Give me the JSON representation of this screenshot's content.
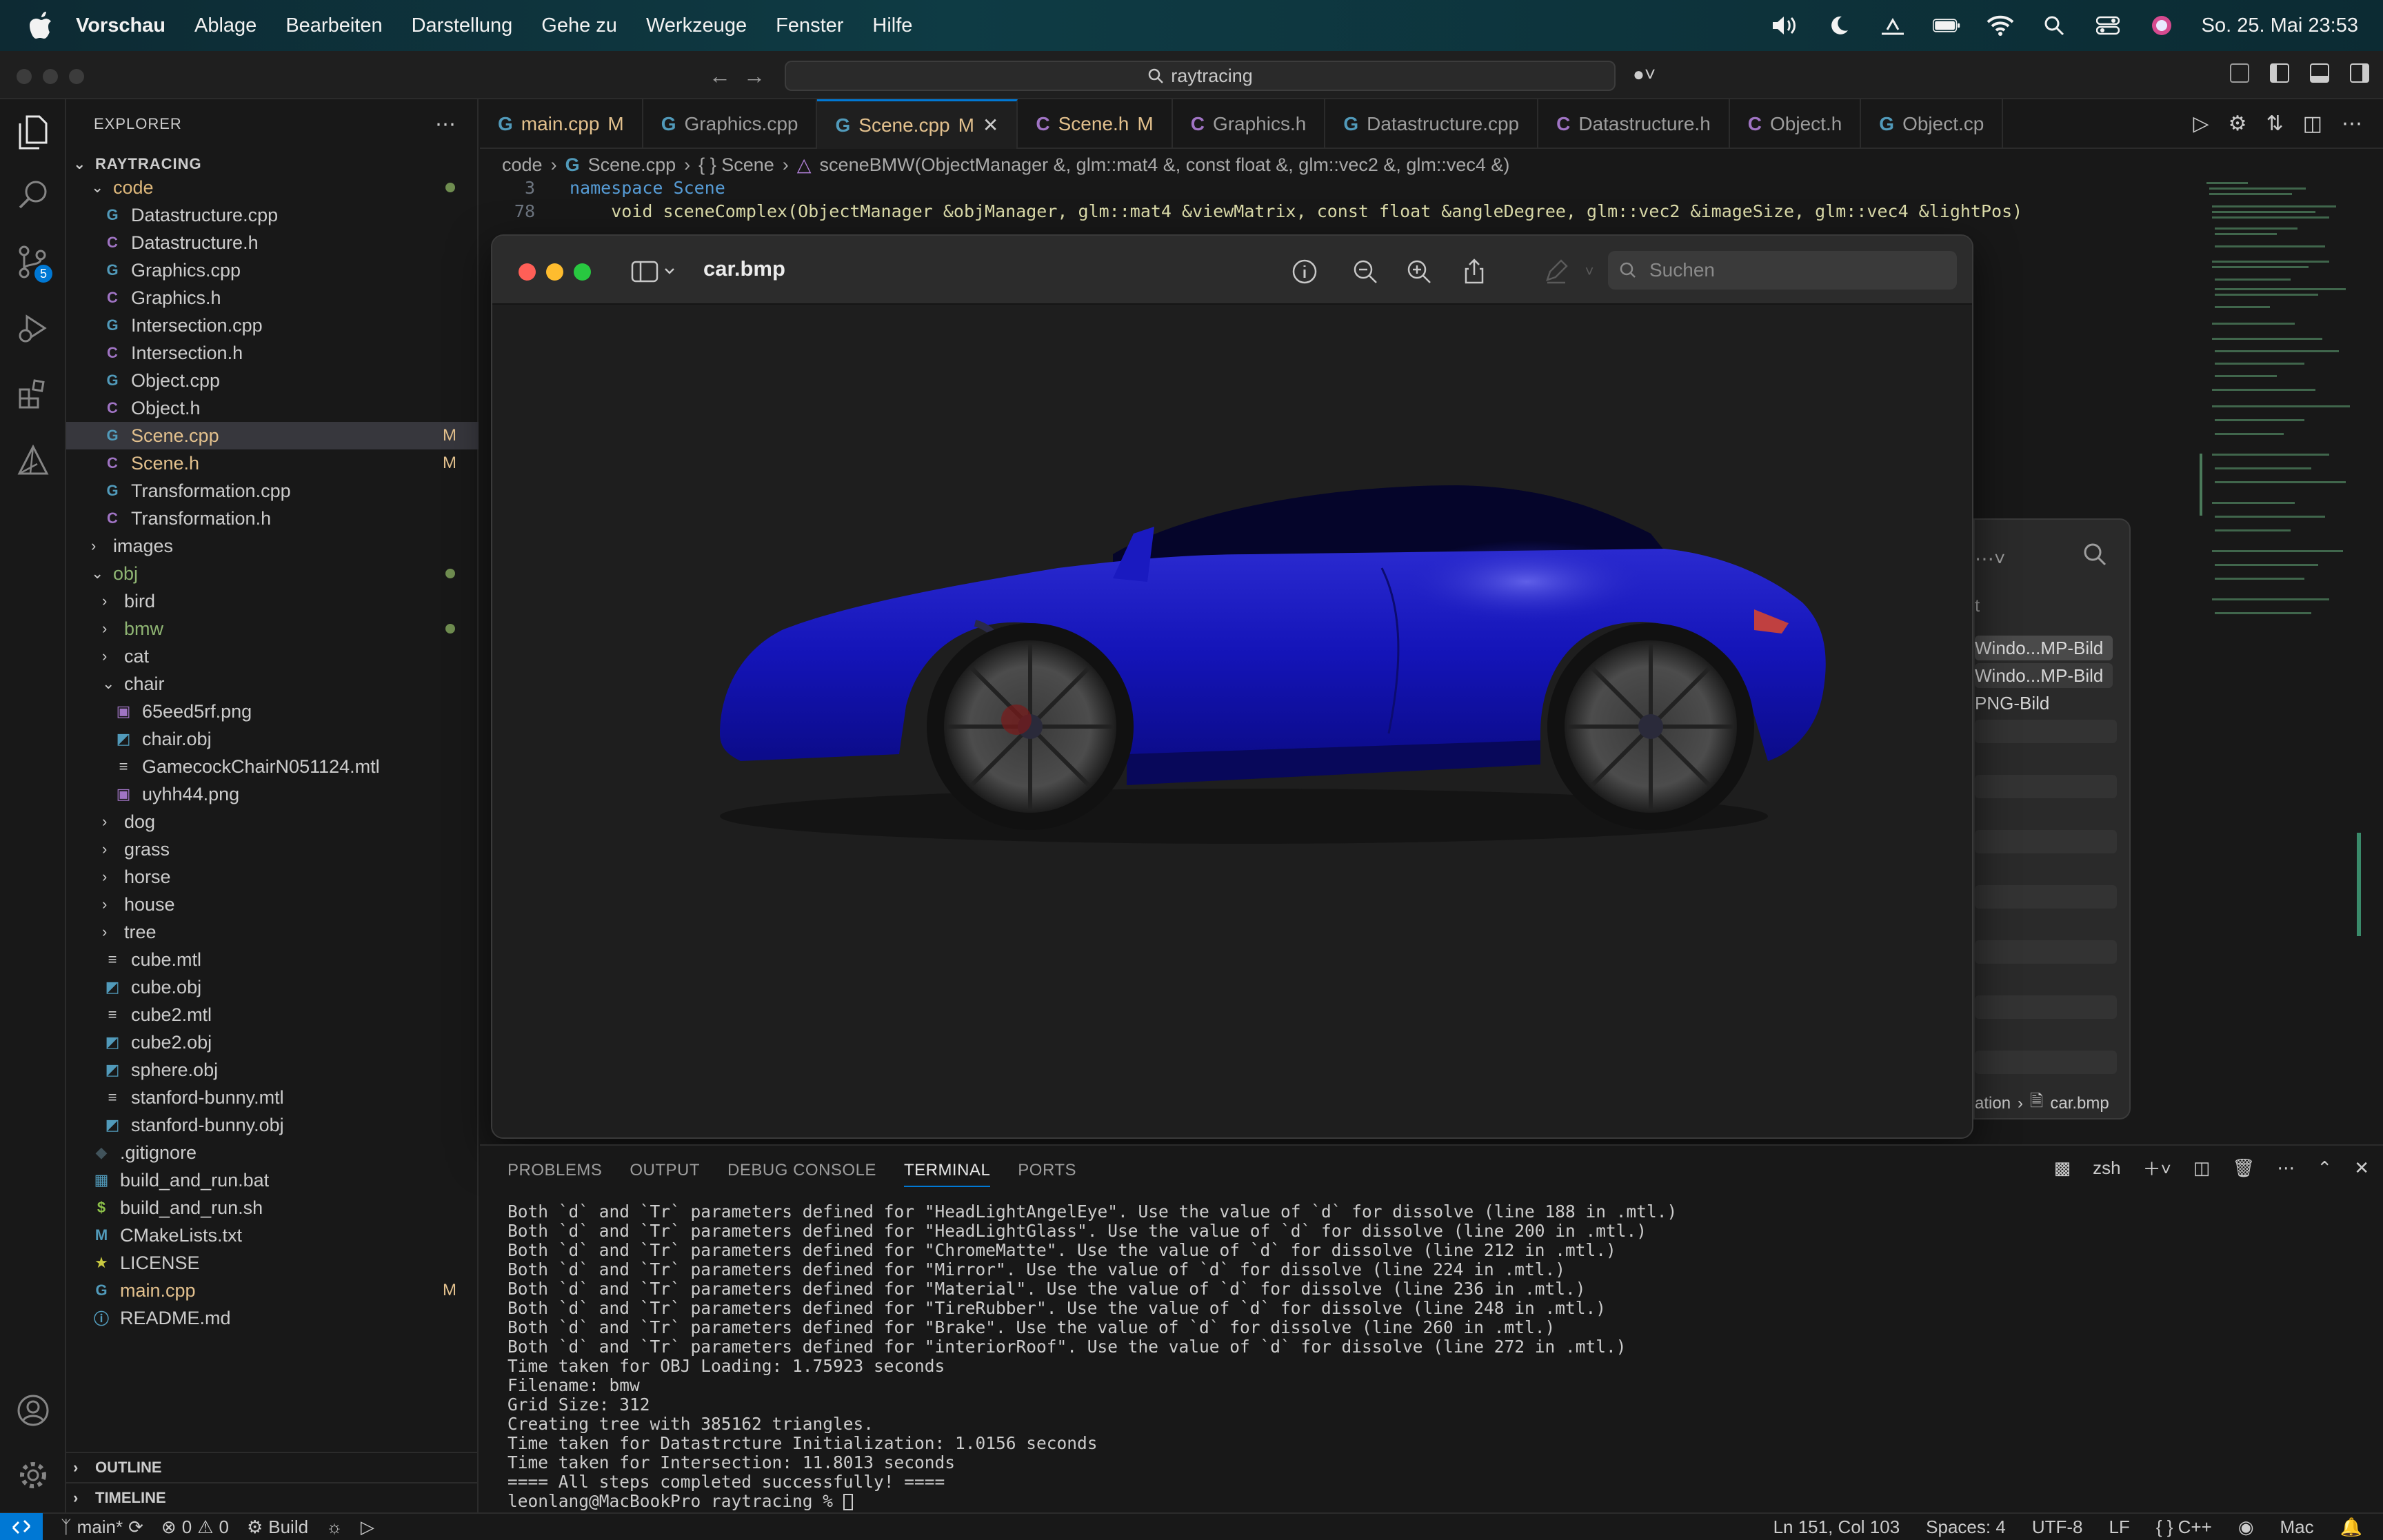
{
  "menubar": {
    "app": "Vorschau",
    "items": [
      "Ablage",
      "Bearbeiten",
      "Darstellung",
      "Gehe zu",
      "Werkzeuge",
      "Fenster",
      "Hilfe"
    ],
    "clock": "So. 25. Mai 23:53"
  },
  "titlebar": {
    "search": "raytracing"
  },
  "explorer": {
    "header": "EXPLORER",
    "root": "RAYTRACING",
    "outline": "OUTLINE",
    "timeline": "TIMELINE",
    "items": [
      {
        "label": "code",
        "kind": "folder-open",
        "depth": 1,
        "color": "#dcb67a",
        "dot": true
      },
      {
        "label": "Datastructure.cpp",
        "kind": "cpp",
        "depth": 2
      },
      {
        "label": "Datastructure.h",
        "kind": "h",
        "depth": 2
      },
      {
        "label": "Graphics.cpp",
        "kind": "cpp",
        "depth": 2
      },
      {
        "label": "Graphics.h",
        "kind": "h",
        "depth": 2
      },
      {
        "label": "Intersection.cpp",
        "kind": "cpp",
        "depth": 2
      },
      {
        "label": "Intersection.h",
        "kind": "h",
        "depth": 2
      },
      {
        "label": "Object.cpp",
        "kind": "cpp",
        "depth": 2
      },
      {
        "label": "Object.h",
        "kind": "h",
        "depth": 2
      },
      {
        "label": "Scene.cpp",
        "kind": "cpp",
        "depth": 2,
        "badge": "M",
        "selected": true,
        "color": "#e2c08d"
      },
      {
        "label": "Scene.h",
        "kind": "h",
        "depth": 2,
        "badge": "M",
        "color": "#e2c08d"
      },
      {
        "label": "Transformation.cpp",
        "kind": "cpp",
        "depth": 2
      },
      {
        "label": "Transformation.h",
        "kind": "h",
        "depth": 2
      },
      {
        "label": "images",
        "kind": "folder",
        "depth": 1
      },
      {
        "label": "obj",
        "kind": "folder-open",
        "depth": 1,
        "color": "#8fb573",
        "dot": true
      },
      {
        "label": "bird",
        "kind": "folder",
        "depth": 2
      },
      {
        "label": "bmw",
        "kind": "folder",
        "depth": 2,
        "color": "#8fb573",
        "dot": true
      },
      {
        "label": "cat",
        "kind": "folder",
        "depth": 2
      },
      {
        "label": "chair",
        "kind": "folder-open",
        "depth": 2
      },
      {
        "label": "65eed5rf.png",
        "kind": "img",
        "depth": 3
      },
      {
        "label": "chair.obj",
        "kind": "obj",
        "depth": 3
      },
      {
        "label": "GamecockChairN051124.mtl",
        "kind": "txt",
        "depth": 3
      },
      {
        "label": "uyhh44.png",
        "kind": "img",
        "depth": 3
      },
      {
        "label": "dog",
        "kind": "folder",
        "depth": 2
      },
      {
        "label": "grass",
        "kind": "folder",
        "depth": 2
      },
      {
        "label": "horse",
        "kind": "folder",
        "depth": 2
      },
      {
        "label": "house",
        "kind": "folder",
        "depth": 2
      },
      {
        "label": "tree",
        "kind": "folder",
        "depth": 2
      },
      {
        "label": "cube.mtl",
        "kind": "txt",
        "depth": 2
      },
      {
        "label": "cube.obj",
        "kind": "obj",
        "depth": 2
      },
      {
        "label": "cube2.mtl",
        "kind": "txt",
        "depth": 2
      },
      {
        "label": "cube2.obj",
        "kind": "obj",
        "depth": 2
      },
      {
        "label": "sphere.obj",
        "kind": "obj",
        "depth": 2
      },
      {
        "label": "stanford-bunny.mtl",
        "kind": "txt",
        "depth": 2
      },
      {
        "label": "stanford-bunny.obj",
        "kind": "obj",
        "depth": 2
      },
      {
        "label": ".gitignore",
        "kind": "git",
        "depth": 1
      },
      {
        "label": "build_and_run.bat",
        "kind": "bat",
        "depth": 1
      },
      {
        "label": "build_and_run.sh",
        "kind": "sh",
        "depth": 1
      },
      {
        "label": "CMakeLists.txt",
        "kind": "cmake",
        "depth": 1
      },
      {
        "label": "LICENSE",
        "kind": "license",
        "depth": 1
      },
      {
        "label": "main.cpp",
        "kind": "cpp",
        "depth": 1,
        "badge": "M",
        "color": "#e2c08d"
      },
      {
        "label": "README.md",
        "kind": "info",
        "depth": 1
      }
    ]
  },
  "tabs": [
    {
      "label": "main.cpp",
      "kind": "cpp",
      "badge": "M"
    },
    {
      "label": "Graphics.cpp",
      "kind": "cpp"
    },
    {
      "label": "Scene.cpp",
      "kind": "cpp",
      "badge": "M",
      "active": true
    },
    {
      "label": "Scene.h",
      "kind": "h",
      "badge": "M"
    },
    {
      "label": "Graphics.h",
      "kind": "h"
    },
    {
      "label": "Datastructure.cpp",
      "kind": "cpp"
    },
    {
      "label": "Datastructure.h",
      "kind": "h"
    },
    {
      "label": "Object.h",
      "kind": "h"
    },
    {
      "label": "Object.cp",
      "kind": "cpp"
    }
  ],
  "breadcrumb": [
    "code",
    "Scene.cpp",
    "{ } Scene",
    "sceneBMW(ObjectManager &, glm::mat4 &, const float &, glm::vec2 &, glm::vec4 &)"
  ],
  "code": {
    "line1_no": "3",
    "line1": "namespace Scene",
    "line2_no": "78",
    "line2": "    void sceneComplex(ObjectManager &objManager, glm::mat4 &viewMatrix, const float &angleDegree, glm::vec2 &imageSize, glm::vec4 &lightPos)"
  },
  "preview": {
    "title": "car.bmp",
    "search_placeholder": "Suchen",
    "car_color": "#1a1aa8"
  },
  "background_window": {
    "rows": [
      "Windo...MP-Bild",
      "Windo...MP-Bild",
      "PNG-Bild"
    ],
    "letter": "t",
    "path_prefix": "ation",
    "path_file": "car.bmp"
  },
  "panel": {
    "tabs": [
      "PROBLEMS",
      "OUTPUT",
      "DEBUG CONSOLE",
      "TERMINAL",
      "PORTS"
    ],
    "active_tab": "TERMINAL",
    "shell": "zsh",
    "terminal_lines": [
      "Both `d` and `Tr` parameters defined for \"HeadLightAngelEye\". Use the value of `d` for dissolve (line 188 in .mtl.)",
      "Both `d` and `Tr` parameters defined for \"HeadLightGlass\". Use the value of `d` for dissolve (line 200 in .mtl.)",
      "Both `d` and `Tr` parameters defined for \"ChromeMatte\". Use the value of `d` for dissolve (line 212 in .mtl.)",
      "Both `d` and `Tr` parameters defined for \"Mirror\". Use the value of `d` for dissolve (line 224 in .mtl.)",
      "Both `d` and `Tr` parameters defined for \"Material\". Use the value of `d` for dissolve (line 236 in .mtl.)",
      "Both `d` and `Tr` parameters defined for \"TireRubber\". Use the value of `d` for dissolve (line 248 in .mtl.)",
      "Both `d` and `Tr` parameters defined for \"Brake\". Use the value of `d` for dissolve (line 260 in .mtl.)",
      "Both `d` and `Tr` parameters defined for \"interiorRoof\". Use the value of `d` for dissolve (line 272 in .mtl.)",
      "Time taken for OBJ Loading: 1.75923 seconds",
      "Filename: bmw",
      "Grid Size: 312",
      "Creating tree with 385162 triangles.",
      "Time taken for Datastrcture Initialization: 1.0156 seconds",
      "Time taken for Intersection: 11.8013 seconds",
      "==== All steps completed successfully! ===="
    ],
    "prompt": "leonlang@MacBookPro raytracing % "
  },
  "statusbar": {
    "branch": "main*",
    "errors": "0",
    "warnings": "0",
    "build": "Build",
    "position": "Ln 151, Col 103",
    "spaces": "Spaces: 4",
    "encoding": "UTF-8",
    "eol": "LF",
    "language": "C++",
    "platform": "Mac"
  },
  "colors": {
    "accent": "#0078d4",
    "modified": "#e2c08d",
    "cpp_icon": "#519aba",
    "h_icon": "#a074c4"
  }
}
